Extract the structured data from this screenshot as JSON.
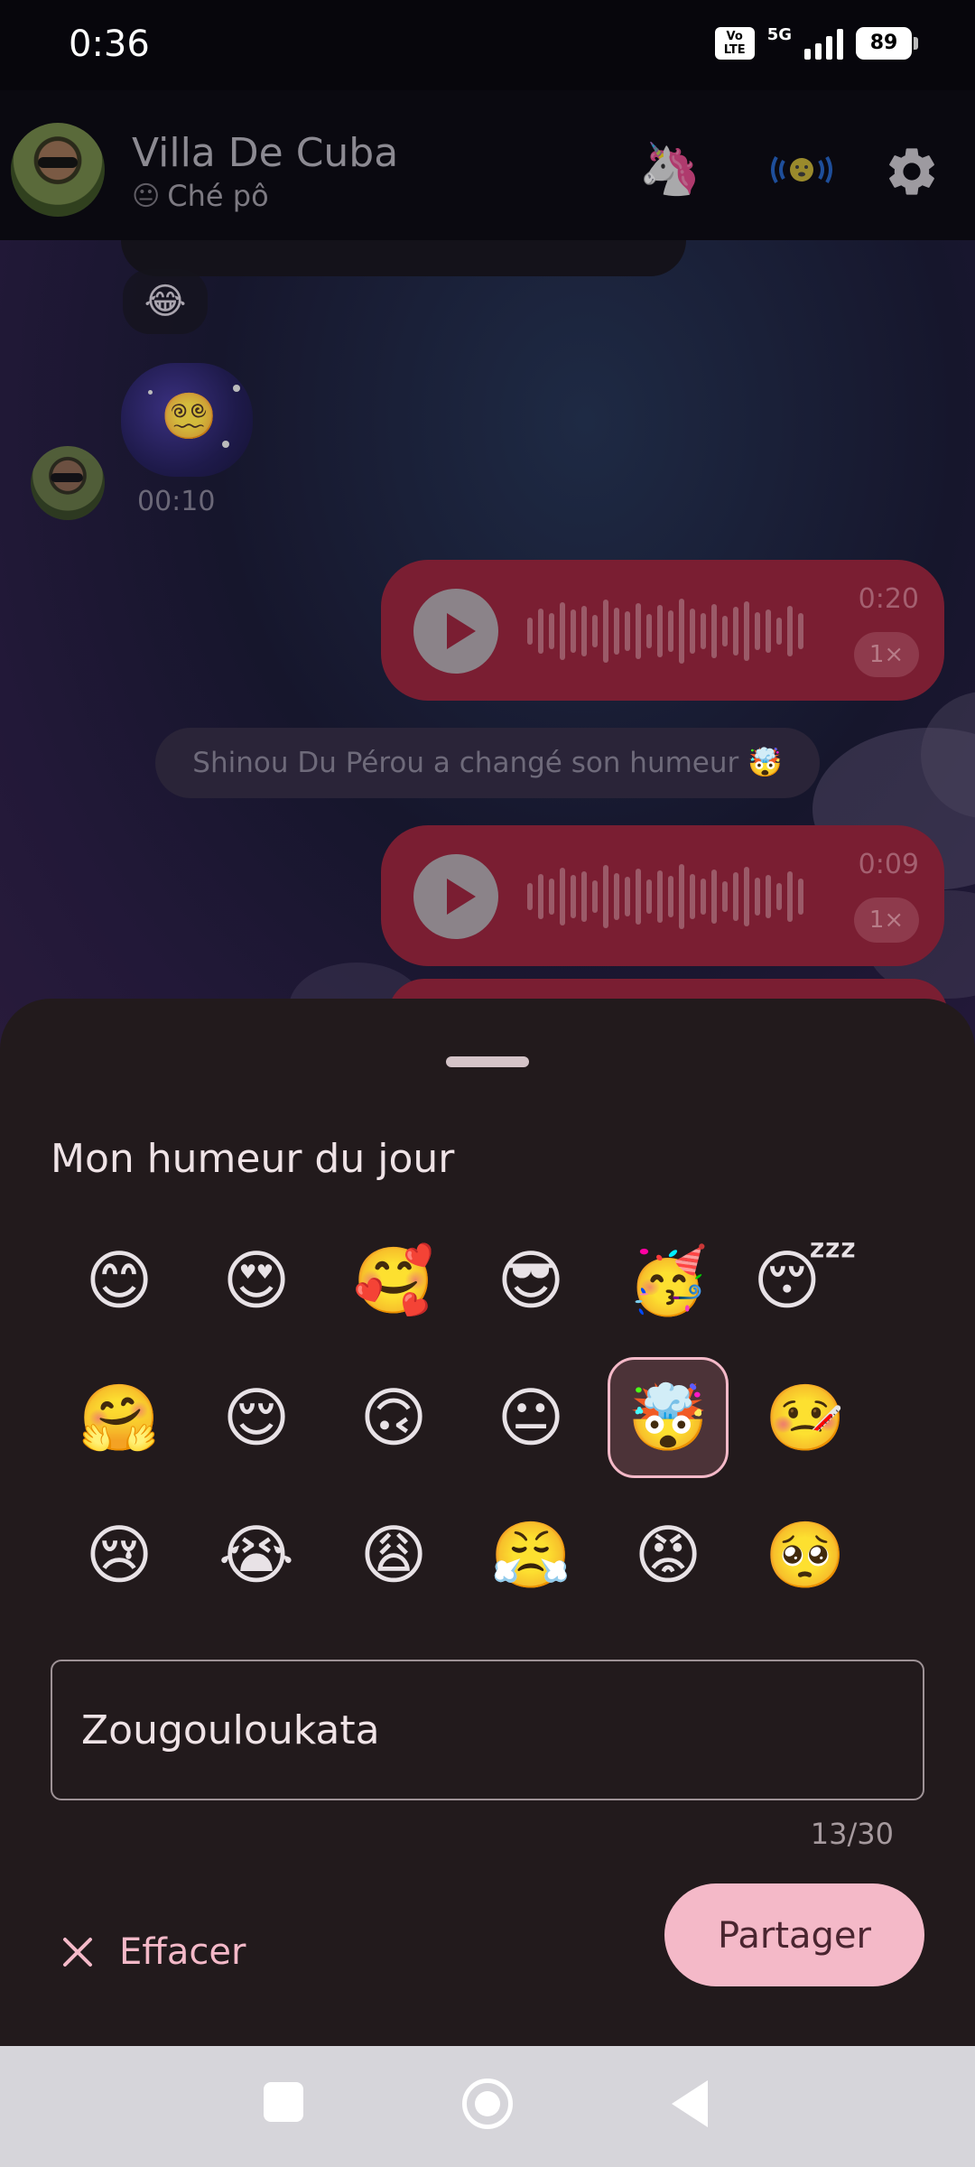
{
  "status_bar": {
    "time": "0:36",
    "volte": "Vo LTE",
    "network": "5G",
    "battery": "89"
  },
  "chat_header": {
    "name": "Villa De Cuba",
    "status_emoji": "😐",
    "status_text": "Ché pô",
    "unicorn_emoji": "🦄",
    "vibe_emoji": "🫨",
    "settings_icon": "gear-icon"
  },
  "chat": {
    "reaction_emoji": "😂",
    "sticker_emoji": "😵‍💫",
    "sticker_time": "00:10",
    "audio_messages": [
      {
        "duration": "0:20",
        "speed": "1×"
      },
      {
        "duration": "0:09",
        "speed": "1×"
      }
    ],
    "system_message": "Shinou Du Pérou a changé son humeur 🤯"
  },
  "mood_sheet": {
    "title": "Mon humeur du jour",
    "emojis": [
      "😊",
      "😍",
      "🥰",
      "😎",
      "🥳",
      "😴",
      "🤗",
      "😌",
      "🙃",
      "😐",
      "🤯",
      "🤒",
      "😢",
      "😭",
      "😩",
      "😤",
      "😡",
      "🥺"
    ],
    "selected_index": 10,
    "input_value": "Zougouloukata",
    "char_count": "13/30",
    "clear_label": "Effacer",
    "share_label": "Partager"
  },
  "colors": {
    "accent": "#f4b9c8",
    "sheet_bg": "#221a1c",
    "audio_bubble": "#7a1e32"
  }
}
